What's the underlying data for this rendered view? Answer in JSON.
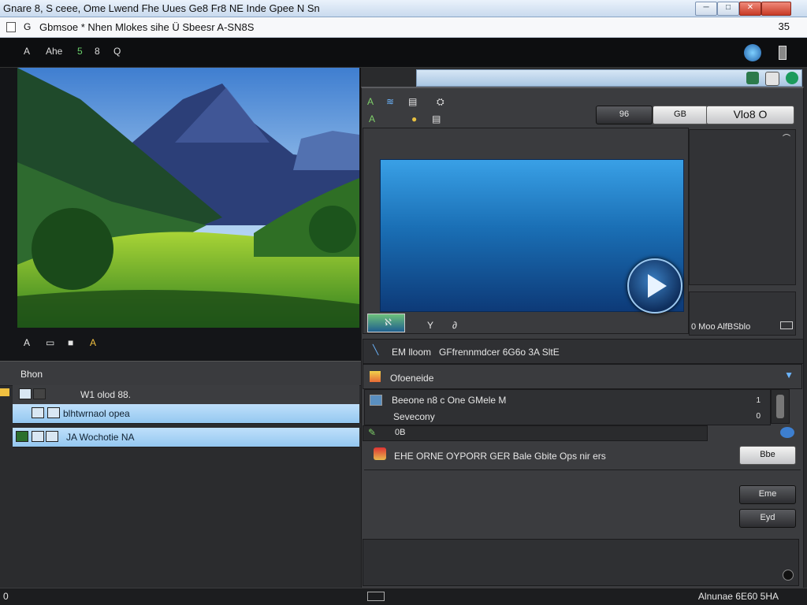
{
  "window": {
    "title": "Gnare 8, S ceee, Ome Lwend Fhe Uues Ge8 Fr8 NE Inde Gpee N Sn",
    "buttons": [
      "─",
      "□",
      "✕"
    ]
  },
  "address_bar": {
    "glyph": "G",
    "text": "Gbmsoe  * Nhen Mlokes  sihe  Ü  Sbeesr A-SN8S",
    "right": "35"
  },
  "toolbar": {
    "items": [
      "A",
      "Ahe",
      "5",
      "8",
      "Q"
    ]
  },
  "photo_tools": {
    "items": [
      "A",
      "▭",
      "■",
      "A"
    ]
  },
  "layers": {
    "header": "Bhon",
    "rows": [
      {
        "label": "W1 olod 88.",
        "style": "dark"
      },
      {
        "label": "blhtwrnaol opea",
        "style": "sel"
      },
      {
        "label": "JA Wochotie NA",
        "style": "sel"
      }
    ]
  },
  "right_panel": {
    "tools_row1": [
      "A",
      "≋",
      "▤",
      "⛭"
    ],
    "tools_row2": [
      "A",
      "●",
      "▤"
    ],
    "buttons": {
      "b1": "96",
      "b2": "GB",
      "b3": "Vlo8 O"
    },
    "under_video": {
      "left": "ℵ",
      "mid": "Y",
      "right": "∂"
    },
    "side_caption": "0  Moo AlfBSblo",
    "field_row": {
      "left": "EM lloom",
      "right": "GFfrennmdcer 6G6o 3A SltE"
    },
    "section1": "Ofoeneide",
    "list": {
      "line1": "Beeone  n8 c  One GMele M",
      "line2": "Sevecony",
      "n1": "1",
      "n2": "0"
    },
    "sub_row": "0B",
    "action_text": "EHE ORNE OYPORR GER Bale Gbite Ops nir ers",
    "btn_a": "Bbe",
    "btn_b": "Eme",
    "btn_c": "Eyd"
  },
  "status_bar": {
    "left": "0",
    "right": "Alnunae 6E60   5HA"
  }
}
